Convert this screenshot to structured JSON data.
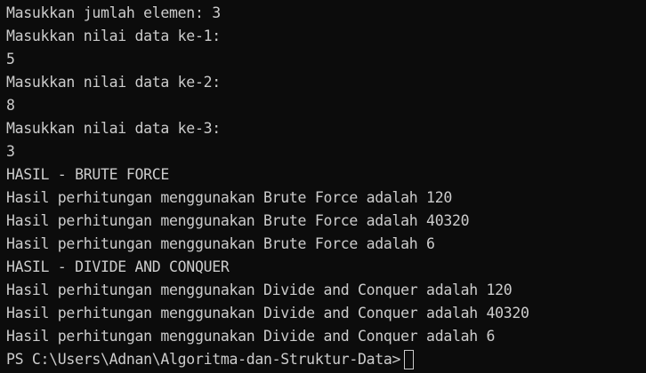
{
  "terminal": {
    "lines": [
      "Masukkan jumlah elemen: 3",
      "Masukkan nilai data ke-1:",
      "5",
      "Masukkan nilai data ke-2:",
      "8",
      "Masukkan nilai data ke-3:",
      "3",
      "HASIL - BRUTE FORCE",
      "Hasil perhitungan menggunakan Brute Force adalah 120",
      "Hasil perhitungan menggunakan Brute Force adalah 40320",
      "Hasil perhitungan menggunakan Brute Force adalah 6",
      "HASIL - DIVIDE AND CONQUER",
      "Hasil perhitungan menggunakan Divide and Conquer adalah 120",
      "Hasil perhitungan menggunakan Divide and Conquer adalah 40320",
      "Hasil perhitungan menggunakan Divide and Conquer adalah 6"
    ],
    "prompt": "PS C:\\Users\\Adnan\\Algoritma-dan-Struktur-Data>",
    "colors": {
      "background": "#0c0c0c",
      "text": "#cccccc"
    }
  }
}
